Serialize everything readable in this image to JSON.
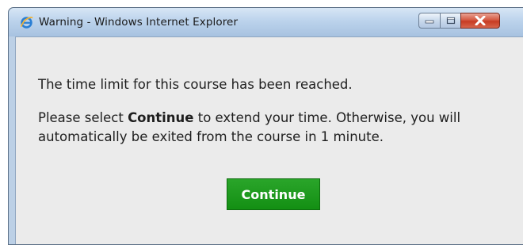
{
  "window": {
    "title": "Warning - Windows Internet Explorer",
    "title_icon": "internet-explorer-icon",
    "controls": [
      "minimize-icon",
      "maximize-icon",
      "close-icon"
    ]
  },
  "dialog": {
    "line1": "The time limit for this course has been reached.",
    "line2_prefix": "Please select ",
    "line2_bold": "Continue",
    "line2_suffix": " to extend your time. Otherwise, you will",
    "line3": "automatically be exited from the course in 1 minute.",
    "continue_label": "Continue"
  },
  "colors": {
    "button_green": "#1a9a1a",
    "close_red": "#d45a43",
    "content_bg": "#ebebeb"
  }
}
